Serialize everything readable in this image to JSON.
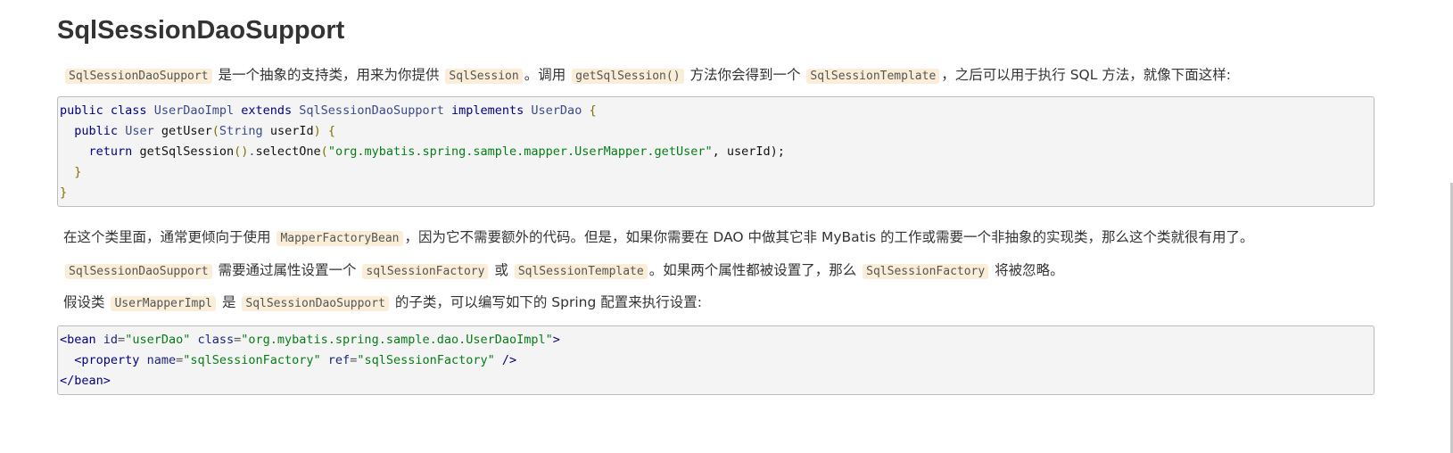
{
  "heading": "SqlSessionDaoSupport",
  "para1": {
    "c1": "SqlSessionDaoSupport",
    "t1": " 是一个抽象的支持类，用来为你提供 ",
    "c2": "SqlSession",
    "t2": "。调用 ",
    "c3": "getSqlSession()",
    "t3": " 方法你会得到一个 ",
    "c4": "SqlSessionTemplate",
    "t4": "，之后可以用于执行 SQL 方法，就像下面这样:"
  },
  "code1": {
    "l1": {
      "kw1": "public",
      "kw2": "class",
      "name": "UserDaoImpl",
      "kw3": "extends",
      "base": "SqlSessionDaoSupport",
      "kw4": "implements",
      "iface": "UserDao",
      "brace": "{"
    },
    "l2": {
      "kw1": "public",
      "type": "User",
      "method": "getUser",
      "open": "(",
      "ptype": "String",
      "pname": "userId",
      "close": ")",
      "brace": "{"
    },
    "l3": {
      "kw": "return",
      "call": "getSqlSession",
      "parens": "()",
      "dot": ".",
      "method": "selectOne",
      "open": "(",
      "str": "\"org.mybatis.spring.sample.mapper.UserMapper.getUser\"",
      "rest": ", userId);"
    },
    "l4": {
      "brace": "}"
    },
    "l5": {
      "brace": "}"
    }
  },
  "para2": {
    "t1": "在这个类里面，通常更倾向于使用 ",
    "c1": "MapperFactoryBean",
    "t2": "，因为它不需要额外的代码。但是，如果你需要在 DAO 中做其它非 MyBatis 的工作或需要一个非抽象的实现类，那么这个类就很有用了。"
  },
  "para3": {
    "c1": "SqlSessionDaoSupport",
    "t1": " 需要通过属性设置一个 ",
    "c2": "sqlSessionFactory",
    "t2": " 或 ",
    "c3": "SqlSessionTemplate",
    "t3": "。如果两个属性都被设置了，那么 ",
    "c4": "SqlSessionFactory",
    "t4": " 将被忽略。"
  },
  "para4": {
    "t1": "假设类 ",
    "c1": "UserMapperImpl",
    "t2": " 是 ",
    "c2": "SqlSessionDaoSupport",
    "t3": " 的子类，可以编写如下的 Spring 配置来执行设置:"
  },
  "code2": {
    "l1": {
      "open": "<bean",
      "a1": "id",
      "eq1": "=",
      "v1": "\"userDao\"",
      "a2": "class",
      "eq2": "=",
      "v2": "\"org.mybatis.spring.sample.dao.UserDaoImpl\"",
      "close": ">"
    },
    "l2": {
      "open": "<property",
      "a1": "name",
      "eq1": "=",
      "v1": "\"sqlSessionFactory\"",
      "a2": "ref",
      "eq2": "=",
      "v2": "\"sqlSessionFactory\"",
      "close": "/>"
    },
    "l3": {
      "tag": "</bean>"
    }
  }
}
